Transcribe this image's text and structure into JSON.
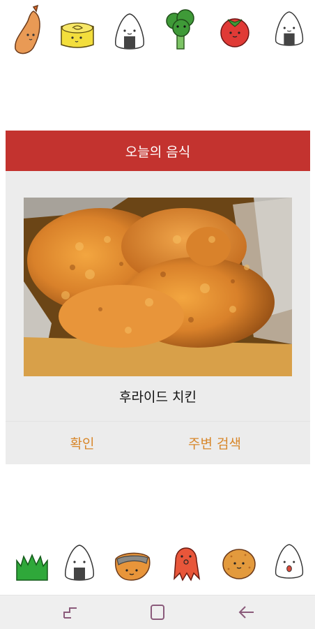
{
  "dialog": {
    "title": "오늘의 음식",
    "dish_name": "후라이드 치킨",
    "image_subject": "fried-chicken-photo",
    "confirm_label": "확인",
    "nearby_search_label": "주변 검색"
  },
  "colors": {
    "header": "#c3332f",
    "button_text": "#d8872b",
    "dialog_bg": "#ececec",
    "navbar_bg": "#efefef"
  },
  "decorations": {
    "top_row": [
      "fried-shrimp-icon",
      "rolled-omelette-icon",
      "onigiri-icon",
      "broccoli-icon",
      "tomato-icon",
      "onigiri-icon"
    ],
    "bottom_row": [
      "grass-divider-icon",
      "onigiri-icon",
      "fried-fish-icon",
      "octopus-sausage-icon",
      "croquette-icon",
      "onigiri-surprised-icon"
    ]
  },
  "navbar": {
    "icons": [
      "recent-apps-icon",
      "home-icon",
      "back-icon"
    ]
  }
}
